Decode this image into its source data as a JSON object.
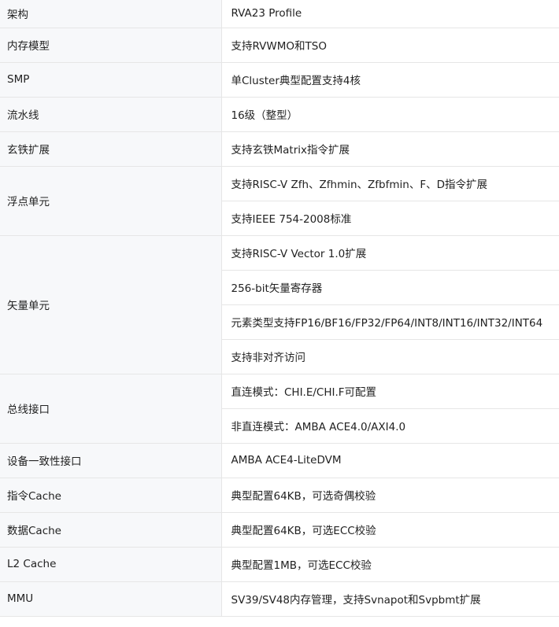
{
  "table": {
    "rows": [
      {
        "label": "架构",
        "values": [
          "RVA23 Profile"
        ]
      },
      {
        "label": "内存模型",
        "values": [
          "支持RVWMO和TSO"
        ]
      },
      {
        "label": "SMP",
        "values": [
          "单Cluster典型配置支持4核"
        ]
      },
      {
        "label": "流水线",
        "values": [
          "16级（整型）"
        ]
      },
      {
        "label": "玄铁扩展",
        "values": [
          "支持玄铁Matrix指令扩展"
        ]
      },
      {
        "label": "浮点单元",
        "values": [
          "支持RISC-V Zfh、Zfhmin、Zfbfmin、F、D指令扩展",
          "支持IEEE 754-2008标准"
        ]
      },
      {
        "label": "矢量单元",
        "values": [
          "支持RISC-V Vector 1.0扩展",
          "256-bit矢量寄存器",
          "元素类型支持FP16/BF16/FP32/FP64/INT8/INT16/INT32/INT64",
          "支持非对齐访问"
        ]
      },
      {
        "label": "总线接口",
        "values": [
          "直连模式：CHI.E/CHI.F可配置",
          "非直连模式：AMBA ACE4.0/AXI4.0"
        ]
      },
      {
        "label": "设备一致性接口",
        "values": [
          "AMBA ACE4-LiteDVM"
        ]
      },
      {
        "label": "指令Cache",
        "values": [
          "典型配置64KB，可选奇偶校验"
        ]
      },
      {
        "label": "数据Cache",
        "values": [
          "典型配置64KB，可选ECC校验"
        ]
      },
      {
        "label": "L2 Cache",
        "values": [
          "典型配置1MB，可选ECC校验"
        ]
      },
      {
        "label": "MMU",
        "values": [
          "SV39/SV48内存管理，支持Svnapot和Svpbmt扩展"
        ]
      }
    ]
  }
}
